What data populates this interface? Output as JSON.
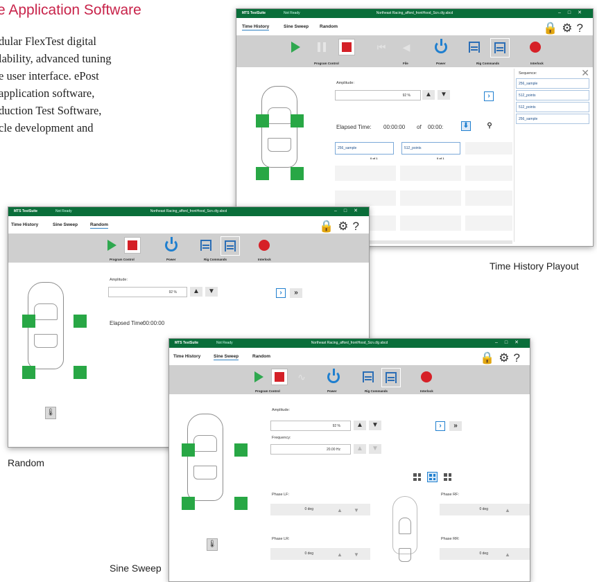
{
  "heading": "e Application Software",
  "paragraph": [
    "dular FlexTest digital",
    "lability, advanced tuning",
    "e user interface. ePost",
    "application software,",
    "duction Test Software,",
    "cle development and"
  ],
  "captions": {
    "time_history": "Time History Playout",
    "random": "Random",
    "sine_sweep": "Sine Sweep"
  },
  "app": {
    "name": "MTS TestSuite",
    "status": "Not Ready",
    "file": "Northeast Racing_afford_frontHood_Scn.cfg abcd",
    "tabs": [
      "Time History",
      "Sine Sweep",
      "Random"
    ]
  },
  "toolbar_labels": {
    "program_control": "Program Control",
    "file": "File",
    "power": "Power",
    "rig_commands": "Rig Commands",
    "interlock": "Interlock"
  },
  "labels": {
    "amplitude": "Amplitude:",
    "frequency": "Frequency:",
    "elapsed_time": "Elapsed Time:",
    "of": "of",
    "phase_lf": "Phase LF:",
    "phase_rf": "Phase RF:",
    "phase_lr": "Phase LR:",
    "phase_rr": "Phase RR:",
    "sequence": "Sequence:"
  },
  "values": {
    "amplitude": "92 %",
    "frequency": "20.00 Hz",
    "elapsed": "00:00:00",
    "total": "00:00:",
    "phase": "0 deg"
  },
  "segments": [
    {
      "name": "256_sample",
      "progress": "0 of 1"
    },
    {
      "name": "512_points",
      "progress": "0 of 1"
    }
  ],
  "sequence_items": [
    "256_sample",
    "512_points",
    "512_points",
    "256_sample"
  ]
}
